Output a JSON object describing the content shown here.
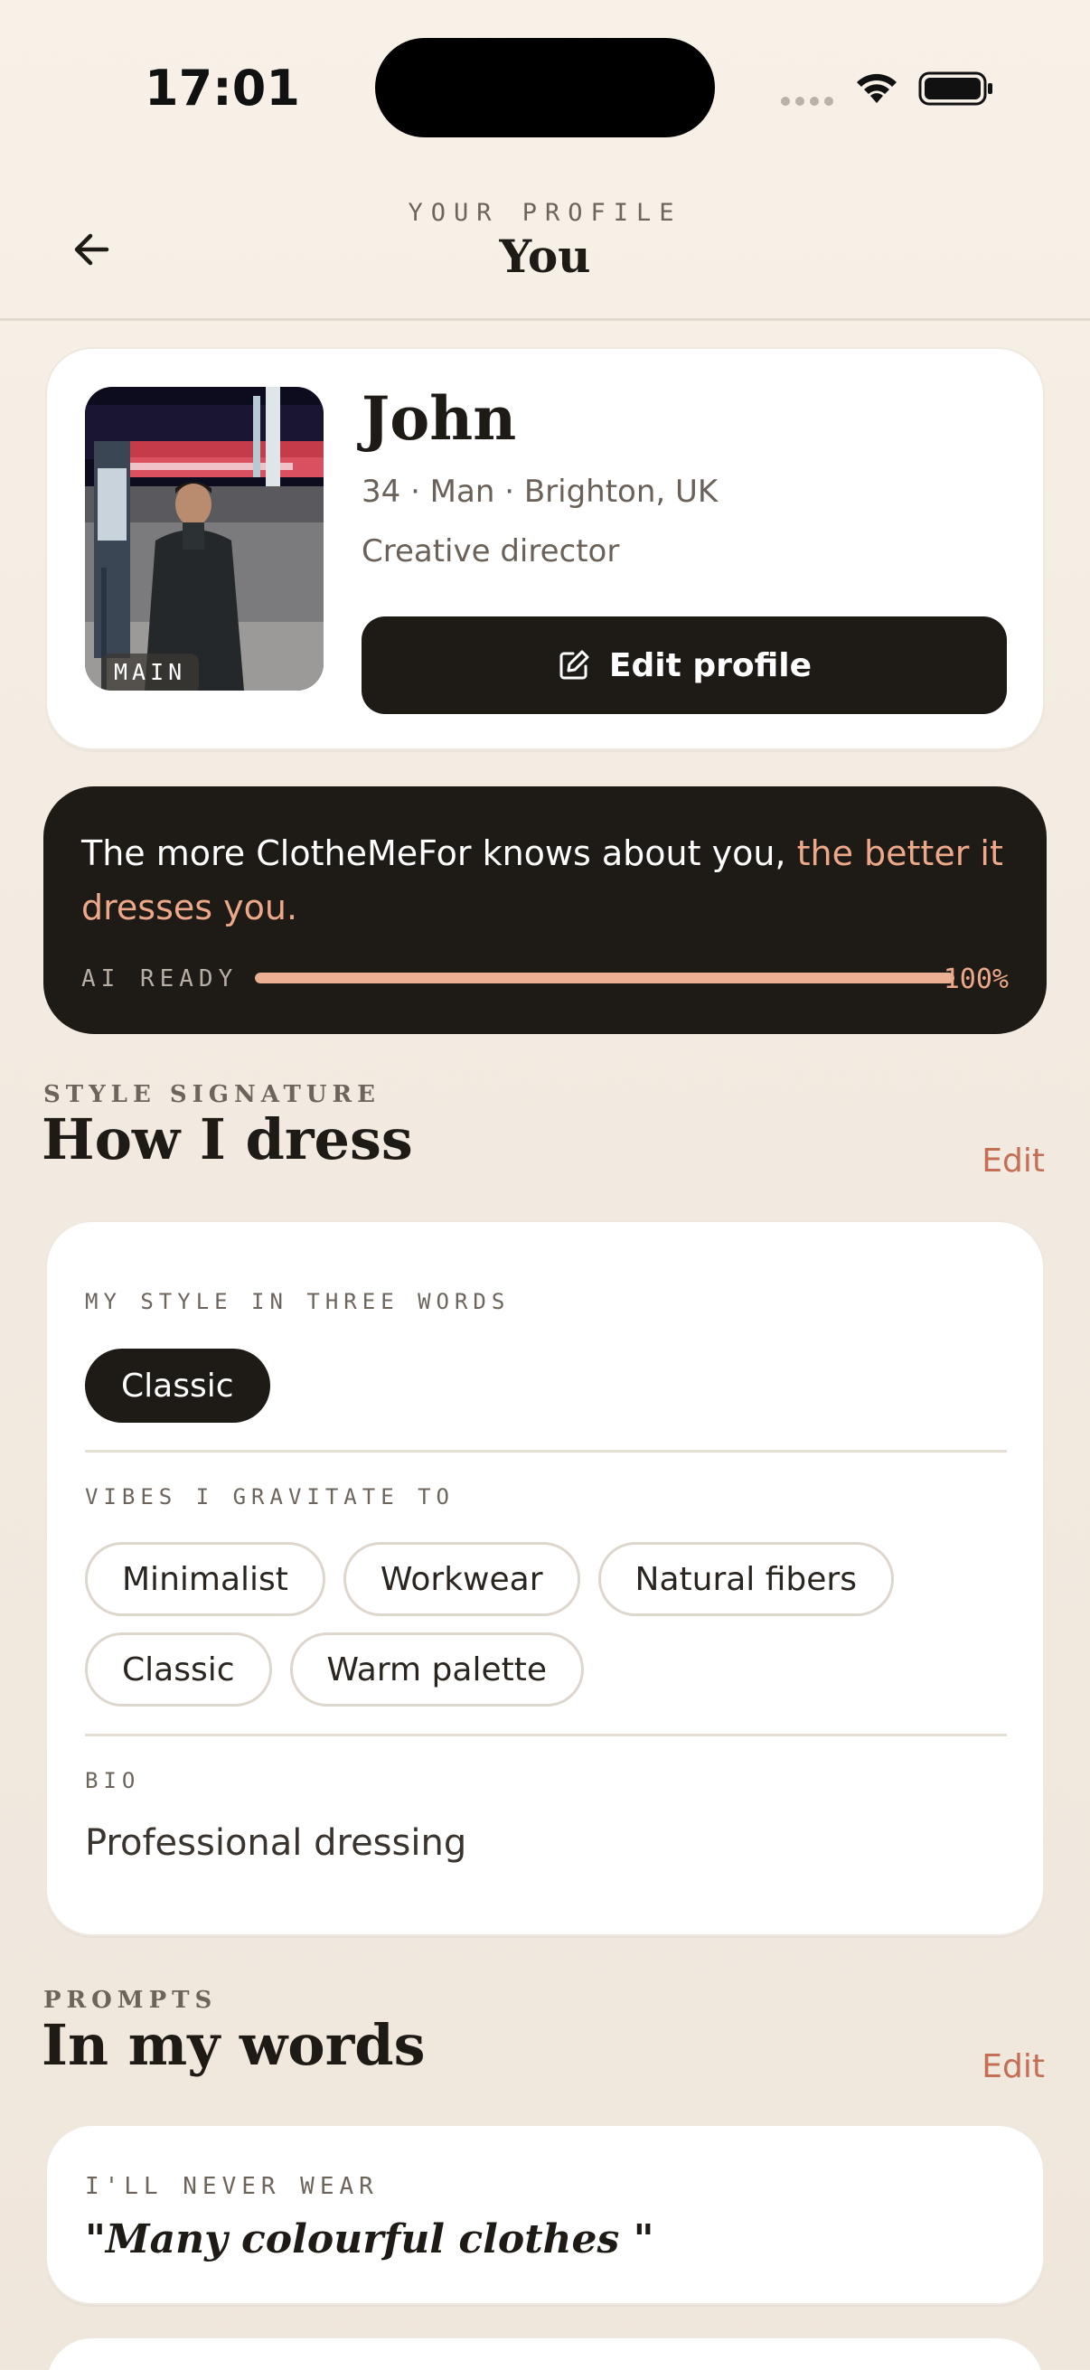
{
  "status_bar": {
    "time": "17:01"
  },
  "header": {
    "eyebrow": "YOUR PROFILE",
    "title": "You"
  },
  "profile": {
    "photo_tag": "MAIN",
    "name": "John",
    "meta": "34 · Man · Brighton, UK",
    "job": "Creative director",
    "edit_label": "Edit profile"
  },
  "ai_card": {
    "text_plain": "The more ClotheMeFor knows about you, ",
    "text_accent": "the better it dresses you.",
    "label": "AI READY",
    "progress_percent": 100,
    "percent_label": "100%"
  },
  "style_section": {
    "eyebrow": "STYLE SIGNATURE",
    "title": "How I dress",
    "edit_label": "Edit",
    "three_words_label": "MY STYLE IN THREE WORDS",
    "three_words": [
      "Classic"
    ],
    "vibes_label": "VIBES I GRAVITATE TO",
    "vibes": [
      "Minimalist",
      "Workwear",
      "Natural fibers",
      "Classic",
      "Warm palette"
    ],
    "bio_label": "BIO",
    "bio": "Professional dressing"
  },
  "prompts_section": {
    "eyebrow": "PROMPTS",
    "title": "In my words",
    "edit_label": "Edit",
    "prompts": [
      {
        "label": "I'LL NEVER WEAR",
        "answer": "\"Many colourful clothes \""
      }
    ]
  },
  "colors": {
    "dark": "#1e1a16",
    "accent": "#c46e54",
    "accent_light": "#eca888"
  }
}
